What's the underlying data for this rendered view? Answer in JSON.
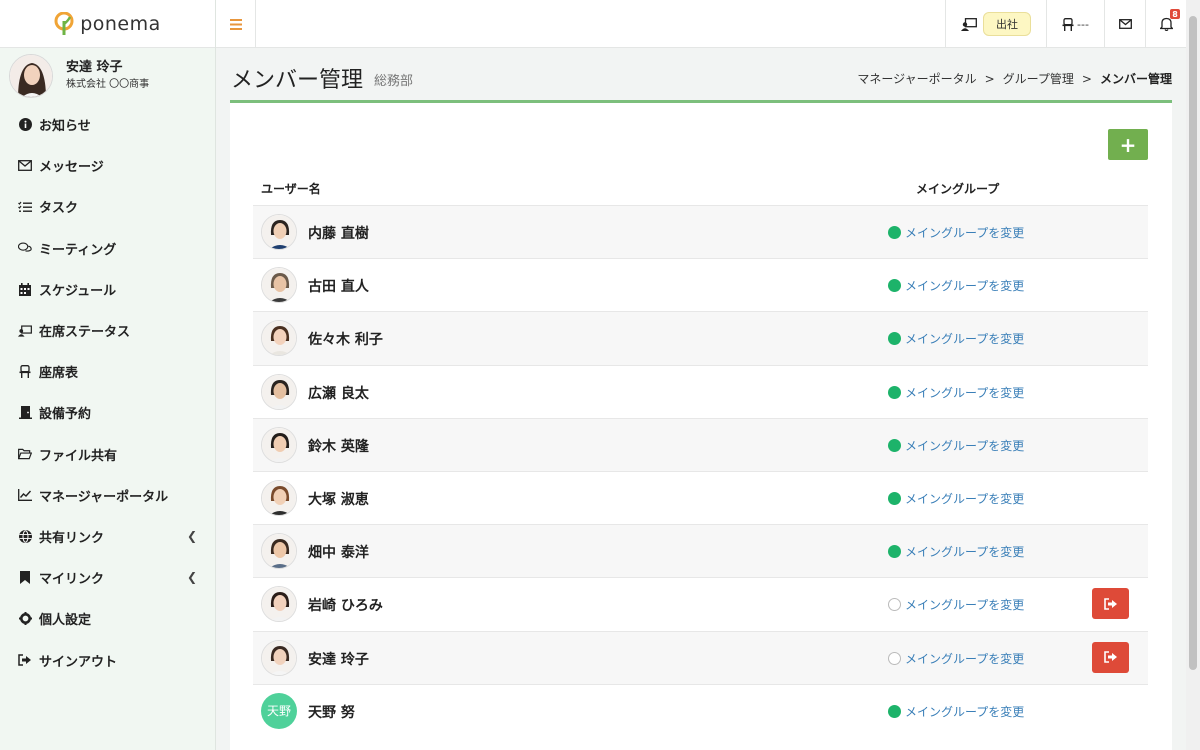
{
  "app": {
    "logo_text": "ponema"
  },
  "profile": {
    "name": "安達 玲子",
    "company": "株式会社 〇〇商事"
  },
  "sidebar": {
    "items": [
      {
        "label": "お知らせ",
        "icon": "info-icon"
      },
      {
        "label": "メッセージ",
        "icon": "envelope-icon"
      },
      {
        "label": "タスク",
        "icon": "checklist-icon"
      },
      {
        "label": "ミーティング",
        "icon": "chat-icon"
      },
      {
        "label": "スケジュール",
        "icon": "calendar-icon"
      },
      {
        "label": "在席ステータス",
        "icon": "presence-icon"
      },
      {
        "label": "座席表",
        "icon": "chair-icon"
      },
      {
        "label": "設備予約",
        "icon": "door-icon"
      },
      {
        "label": "ファイル共有",
        "icon": "folder-icon"
      },
      {
        "label": "マネージャーポータル",
        "icon": "chart-icon"
      },
      {
        "label": "共有リンク",
        "icon": "globe-icon",
        "expandable": true
      },
      {
        "label": "マイリンク",
        "icon": "bookmark-icon",
        "expandable": true
      },
      {
        "label": "個人設定",
        "icon": "gear-icon"
      },
      {
        "label": "サインアウト",
        "icon": "signout-icon"
      }
    ]
  },
  "topbar": {
    "status_label": "出社",
    "seat_label": "---",
    "notification_count": "8"
  },
  "header": {
    "title": "メンバー管理",
    "subtitle": "総務部",
    "breadcrumb": [
      "マネージャーポータル",
      "グループ管理",
      "メンバー管理"
    ]
  },
  "table": {
    "col_user": "ユーザー名",
    "col_group": "メイングループ",
    "link_label": "メイングループを変更",
    "rows": [
      {
        "name": "内藤 直樹",
        "main_group": true,
        "removable": false
      },
      {
        "name": "古田 直人",
        "main_group": true,
        "removable": false
      },
      {
        "name": "佐々木 利子",
        "main_group": true,
        "removable": false
      },
      {
        "name": "広瀬 良太",
        "main_group": true,
        "removable": false
      },
      {
        "name": "鈴木 英隆",
        "main_group": true,
        "removable": false
      },
      {
        "name": "大塚 淑恵",
        "main_group": true,
        "removable": false
      },
      {
        "name": "畑中 泰洋",
        "main_group": true,
        "removable": false
      },
      {
        "name": "岩崎 ひろみ",
        "main_group": false,
        "removable": true
      },
      {
        "name": "安達 玲子",
        "main_group": false,
        "removable": true
      },
      {
        "name": "天野 努",
        "main_group": true,
        "removable": false,
        "initials": "天野"
      }
    ]
  },
  "colors": {
    "accent": "#72af4f",
    "danger": "#de4a38",
    "online": "#1db36a",
    "link": "#3a7fb8"
  }
}
